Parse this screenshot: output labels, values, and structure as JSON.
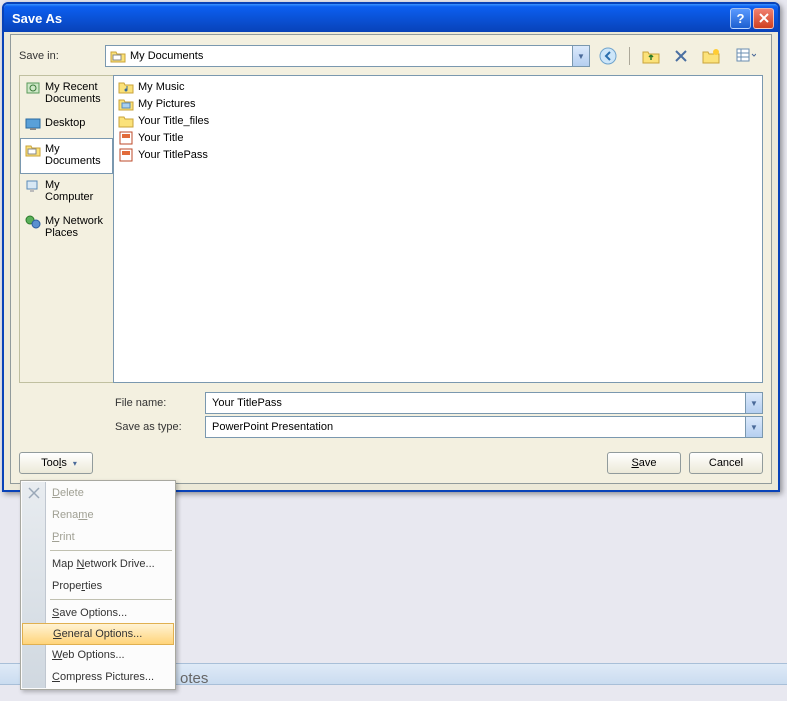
{
  "titlebar": {
    "title": "Save As"
  },
  "savein": {
    "label": "Save in:",
    "value": "My Documents"
  },
  "places": [
    {
      "id": "recent",
      "label": "My Recent Documents"
    },
    {
      "id": "desktop",
      "label": "Desktop"
    },
    {
      "id": "mydocs",
      "label": "My Documents"
    },
    {
      "id": "mycomp",
      "label": "My Computer"
    },
    {
      "id": "network",
      "label": "My Network Places"
    }
  ],
  "files": [
    {
      "icon": "folder-music",
      "name": "My Music"
    },
    {
      "icon": "folder-pictures",
      "name": "My Pictures"
    },
    {
      "icon": "folder",
      "name": "Your Title_files"
    },
    {
      "icon": "ppt",
      "name": "Your Title"
    },
    {
      "icon": "ppt",
      "name": "Your TitlePass"
    }
  ],
  "filename": {
    "label": "File name:",
    "value": "Your TitlePass"
  },
  "savetype": {
    "label": "Save as type:",
    "value": "PowerPoint Presentation"
  },
  "buttons": {
    "tools": "Tools",
    "save_prefix": "",
    "save_u": "S",
    "save_rest": "ave",
    "cancel": "Cancel"
  },
  "tools_menu": [
    {
      "label_u": "D",
      "label_rest": "elete",
      "disabled": true,
      "icon": "x"
    },
    {
      "label_pre": "Rena",
      "label_u": "m",
      "label_rest": "e",
      "disabled": true
    },
    {
      "label_u": "P",
      "label_rest": "rint",
      "disabled": true
    },
    {
      "sep": true
    },
    {
      "label_pre": "Map ",
      "label_u": "N",
      "label_rest": "etwork Drive..."
    },
    {
      "label_pre": "Prope",
      "label_u": "r",
      "label_rest": "ties"
    },
    {
      "sep": true
    },
    {
      "label_u": "S",
      "label_rest": "ave Options..."
    },
    {
      "label_u": "G",
      "label_rest": "eneral Options...",
      "highlight": true
    },
    {
      "label_u": "W",
      "label_rest": "eb Options..."
    },
    {
      "label_u": "C",
      "label_rest": "ompress Pictures..."
    }
  ],
  "background_text": "otes"
}
